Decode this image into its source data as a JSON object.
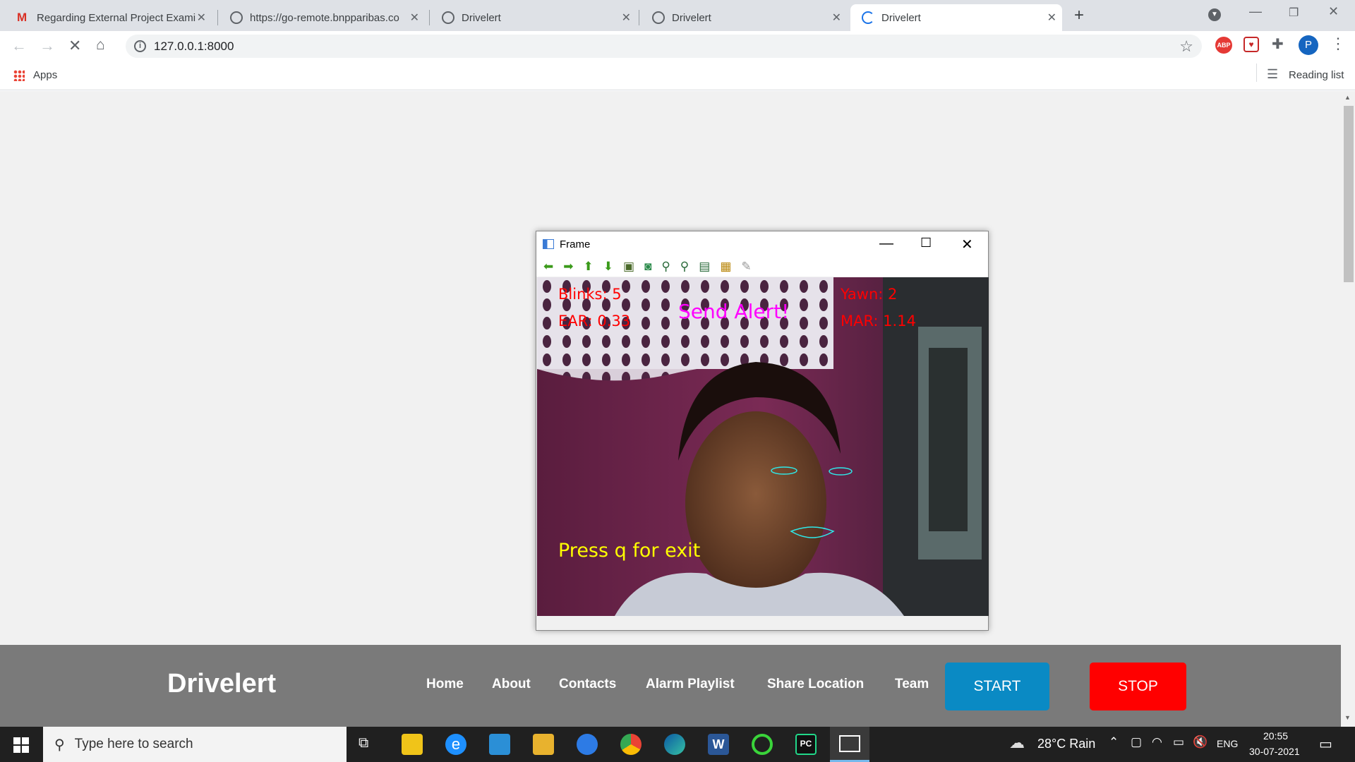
{
  "browser": {
    "tabs": [
      {
        "title": "Regarding External Project Exami",
        "icon": "gmail-icon"
      },
      {
        "title": "https://go-remote.bnpparibas.co",
        "icon": "globe-icon"
      },
      {
        "title": "Drivelert",
        "icon": "globe-icon"
      },
      {
        "title": "Drivelert",
        "icon": "globe-icon"
      },
      {
        "title": "Drivelert",
        "icon": "loading-icon"
      }
    ],
    "url": "127.0.0.1:8000",
    "bookmarks_apps": "Apps",
    "reading_list": "Reading list",
    "profile_initial": "P"
  },
  "frame_window": {
    "title": "Frame",
    "overlay": {
      "blinks": "Blinks: 5",
      "ear": "EAR: 0.33",
      "alert": "Send Alert!",
      "yawn": "Yawn: 2",
      "mar": "MAR: 1.14",
      "exit_hint": "Press q for exit"
    }
  },
  "footer": {
    "brand": "Drivelert",
    "nav": [
      "Home",
      "About",
      "Contacts",
      "Alarm Playlist",
      "Share Location",
      "Team"
    ],
    "start_label": "START",
    "stop_label": "STOP",
    "start_color": "#0a8ac4",
    "stop_color": "#ff0000"
  },
  "taskbar": {
    "search_placeholder": "Type here to search",
    "weather": "28°C  Rain",
    "lang": "ENG",
    "time": "20:55",
    "date": "30-07-2021"
  }
}
